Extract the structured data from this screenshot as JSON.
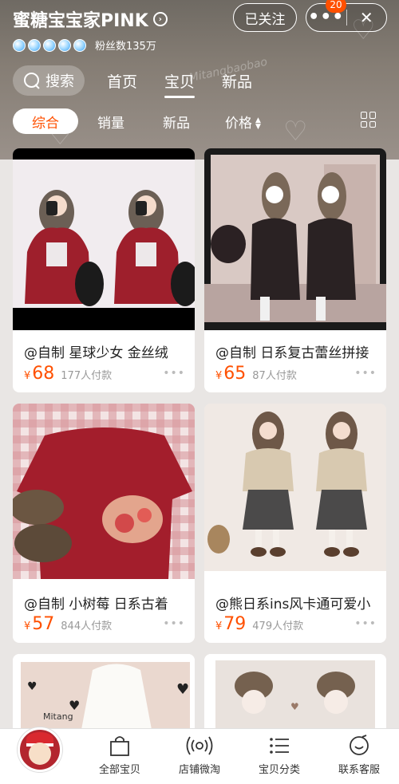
{
  "header": {
    "shop_name": "蜜糖宝宝家PINK",
    "follow_label": "已关注",
    "badge_count": "20",
    "fans_text": "粉丝数135万",
    "watermark_text": "Mitangbaobao"
  },
  "search": {
    "label": "搜索"
  },
  "main_tabs": [
    {
      "label": "首页",
      "active": false
    },
    {
      "label": "宝贝",
      "active": true
    },
    {
      "label": "新品",
      "active": false
    }
  ],
  "filters": [
    {
      "label": "综合",
      "active": true
    },
    {
      "label": "销量",
      "active": false
    },
    {
      "label": "新品",
      "active": false
    },
    {
      "label": "价格",
      "active": false
    }
  ],
  "products": [
    {
      "title": "@自制 星球少女 金丝绒",
      "currency": "¥",
      "price": "68",
      "sold": "177人付款"
    },
    {
      "title": "@自制 日系复古蕾丝拼接",
      "currency": "¥",
      "price": "65",
      "sold": "87人付款"
    },
    {
      "title": "@自制 小树莓 日系古着",
      "currency": "¥",
      "price": "57",
      "sold": "844人付款"
    },
    {
      "title": "@熊日系ins风卡通可爱小",
      "currency": "¥",
      "price": "79",
      "sold": "479人付款"
    }
  ],
  "partial_products": [
    {
      "image_text": "Mitang"
    },
    {
      "image_text": ""
    }
  ],
  "bottom_nav": [
    {
      "label": "全部宝贝",
      "icon": "shopping-bag-icon"
    },
    {
      "label": "店铺微淘",
      "icon": "broadcast-icon"
    },
    {
      "label": "宝贝分类",
      "icon": "list-icon"
    },
    {
      "label": "联系客服",
      "icon": "chat-icon"
    }
  ],
  "colors": {
    "accent": "#ff5000",
    "header_bg": "#7c756d",
    "page_bg": "#e9e6e4"
  }
}
